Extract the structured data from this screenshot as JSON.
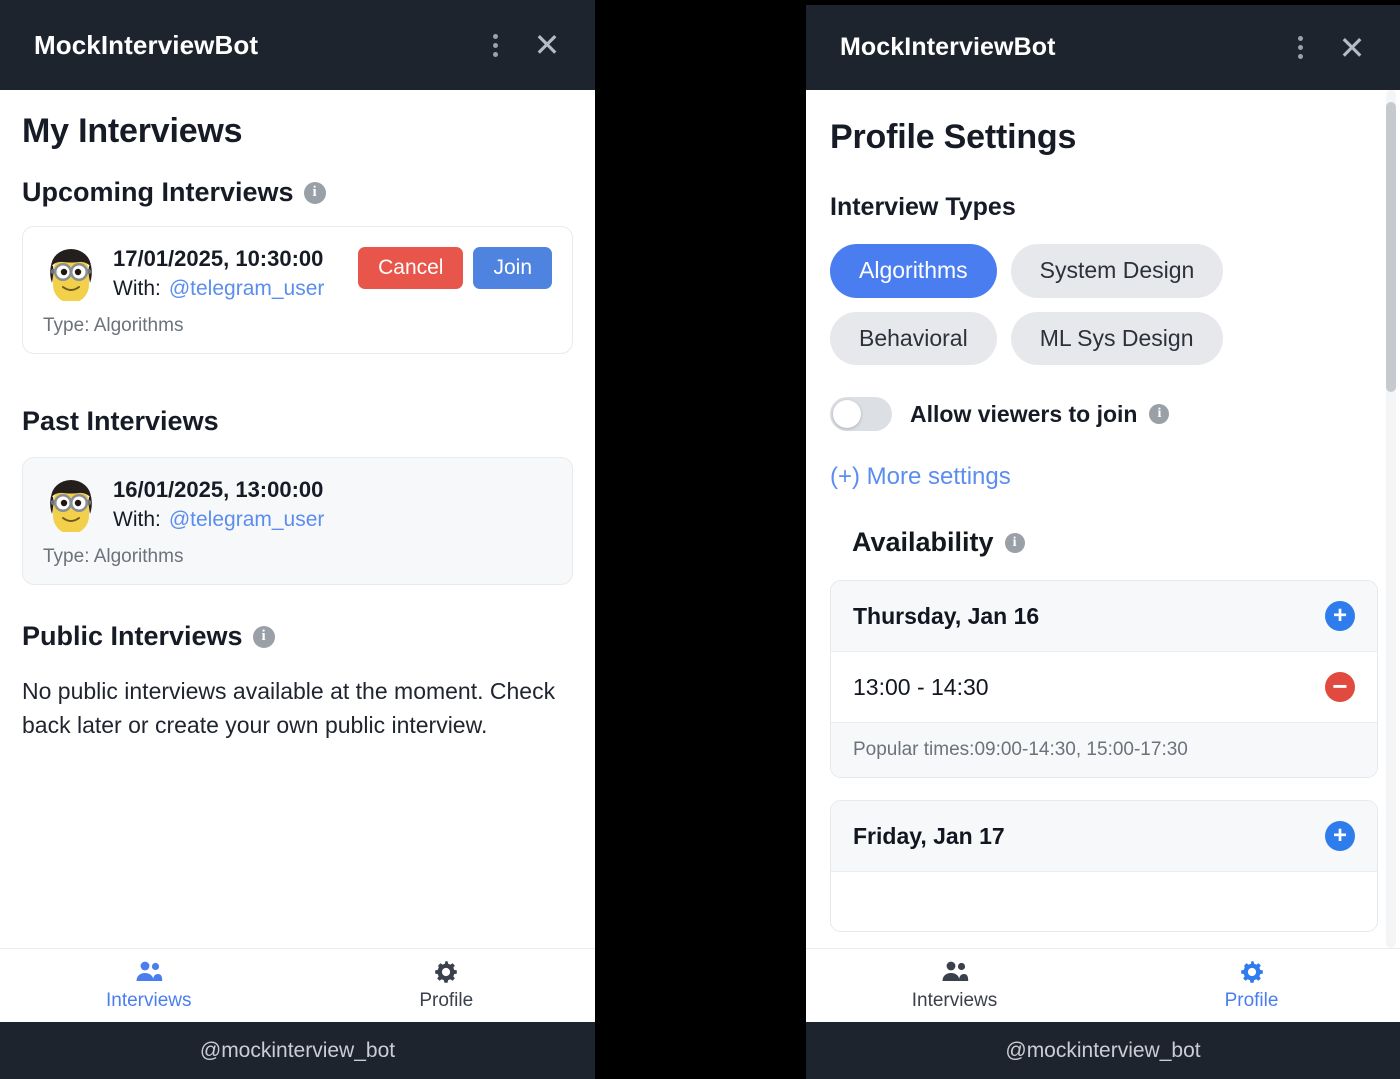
{
  "window": {
    "title": "MockInterviewBot",
    "menu_icon": "three-dots-vertical-icon",
    "close_icon": "close-icon",
    "footer_handle": "@mockinterview_bot"
  },
  "left_panel": {
    "page_title": "My Interviews",
    "upcoming": {
      "heading": "Upcoming Interviews",
      "info_glyph": "i",
      "items": [
        {
          "date": "17/01/2025, 10:30:00",
          "with_label": "With:",
          "username": "@telegram_user",
          "type_label": "Type: Algorithms",
          "cancel_label": "Cancel",
          "join_label": "Join",
          "avatar": "minion-avatar"
        }
      ]
    },
    "past": {
      "heading": "Past Interviews",
      "items": [
        {
          "date": "16/01/2025, 13:00:00",
          "with_label": "With:",
          "username": "@telegram_user",
          "type_label": "Type: Algorithms",
          "avatar": "minion-avatar"
        }
      ]
    },
    "public": {
      "heading": "Public Interviews",
      "info_glyph": "i",
      "empty_text": "No public interviews available at the moment. Check back later or create your own public interview."
    },
    "nav": {
      "items": [
        {
          "label": "Interviews",
          "icon": "people-icon",
          "active": true
        },
        {
          "label": "Profile",
          "icon": "gear-icon",
          "active": false
        }
      ]
    }
  },
  "right_panel": {
    "page_title": "Profile Settings",
    "interview_types": {
      "heading": "Interview Types",
      "options": [
        {
          "label": "Algorithms",
          "selected": true
        },
        {
          "label": "System Design",
          "selected": false
        },
        {
          "label": "Behavioral",
          "selected": false
        },
        {
          "label": "ML Sys Design",
          "selected": false
        }
      ]
    },
    "allow_viewers": {
      "label": "Allow viewers to join",
      "state": "off",
      "info_glyph": "i"
    },
    "more_settings_label": "(+) More settings",
    "availability": {
      "heading": "Availability",
      "info_glyph": "i",
      "days": [
        {
          "title": "Thursday, Jan 16",
          "add_glyph": "+",
          "slots": [
            {
              "time": "13:00 - 14:30",
              "remove_glyph": "−"
            }
          ],
          "popular_label": "Popular times:",
          "popular_values": "09:00-14:30, 15:00-17:30"
        },
        {
          "title": "Friday, Jan 17",
          "add_glyph": "+",
          "slots": [],
          "popular_label": "",
          "popular_values": ""
        }
      ]
    },
    "nav": {
      "items": [
        {
          "label": "Interviews",
          "icon": "people-icon",
          "active": false
        },
        {
          "label": "Profile",
          "icon": "gear-icon",
          "active": true
        }
      ]
    }
  },
  "colors": {
    "accent_blue": "#4a7ef0",
    "danger_red": "#e8554a",
    "titlebar": "#1e242e",
    "link_blue": "#5b8def"
  }
}
